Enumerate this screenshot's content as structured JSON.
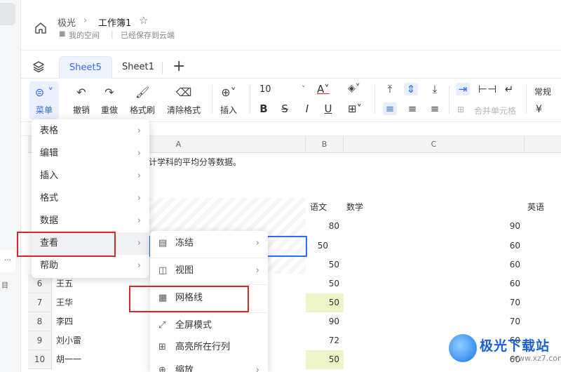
{
  "header": {
    "breadcrumb_root": "极光",
    "doc_title": "工作簿1",
    "space": "我的空间",
    "save_status": "已经保存到云端"
  },
  "tabs": [
    {
      "label": "Sheet5",
      "active": true
    },
    {
      "label": "Sheet1",
      "active": false
    }
  ],
  "toolbar": {
    "menu_label": "菜单",
    "undo_label": "撤销",
    "redo_label": "重做",
    "format_painter_label": "格式刷",
    "clear_format_label": "清除格式",
    "insert_label": "插入",
    "font_size": "10",
    "merge_label": "合并单元格",
    "number_format": "常规",
    "currency_symbol": "¥"
  },
  "columns": [
    "A",
    "B",
    "C"
  ],
  "sheet": {
    "intro_text": "计学科的平均分等数据。",
    "headers": {
      "chinese": "语文",
      "math": "数学",
      "english": "英语"
    },
    "rows": [
      {
        "row": "",
        "name": "",
        "chinese": "80",
        "english": "90",
        "hl": false
      },
      {
        "row": "",
        "name": "",
        "chinese": "50",
        "english": "60",
        "hl": false
      },
      {
        "row": "",
        "name": "",
        "chinese": "50",
        "english": "60",
        "hl": false
      },
      {
        "row": "6",
        "name": "王五",
        "chinese": "50",
        "english": "60",
        "hl": false
      },
      {
        "row": "7",
        "name": "王华",
        "chinese": "50",
        "english": "70",
        "hl": true
      },
      {
        "row": "8",
        "name": "李四",
        "chinese": "90",
        "english": "70",
        "hl": false
      },
      {
        "row": "9",
        "name": "刘小雷",
        "chinese": "72",
        "english": "60",
        "hl": false
      },
      {
        "row": "10",
        "name": "胡一一",
        "chinese": "50",
        "english": "60",
        "hl": true
      }
    ]
  },
  "menu": {
    "items": [
      {
        "label": "表格"
      },
      {
        "label": "编辑"
      },
      {
        "label": "插入"
      },
      {
        "label": "格式"
      },
      {
        "label": "数据"
      },
      {
        "label": "查看"
      },
      {
        "label": "帮助"
      }
    ]
  },
  "submenu": {
    "items": [
      {
        "label": "冻结"
      },
      {
        "label": "视图"
      },
      {
        "label": "网格线"
      },
      {
        "label": "全屏模式"
      },
      {
        "label": "高亮所在行列"
      },
      {
        "label": "缩放"
      }
    ]
  },
  "watermark": {
    "brand": "极光下载站",
    "url": "www.xz7.com"
  },
  "colors": {
    "accent": "#2f6bff",
    "highlight_box": "#d9262c",
    "cell_highlight": "#eef6c9"
  }
}
